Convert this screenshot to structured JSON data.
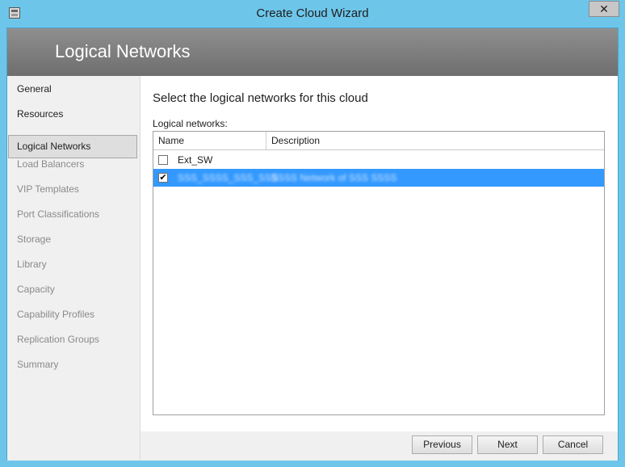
{
  "window": {
    "title": "Create Cloud Wizard",
    "close_label": "✕"
  },
  "header": {
    "title": "Logical Networks"
  },
  "nav": {
    "items": [
      {
        "label": "General",
        "state": "enabled"
      },
      {
        "label": "Resources",
        "state": "enabled"
      },
      {
        "label": "Logical Networks",
        "state": "selected"
      },
      {
        "label": "Load Balancers",
        "state": "disabled"
      },
      {
        "label": "VIP Templates",
        "state": "disabled"
      },
      {
        "label": "Port Classifications",
        "state": "disabled"
      },
      {
        "label": "Storage",
        "state": "disabled"
      },
      {
        "label": "Library",
        "state": "disabled"
      },
      {
        "label": "Capacity",
        "state": "disabled"
      },
      {
        "label": "Capability Profiles",
        "state": "disabled"
      },
      {
        "label": "Replication Groups",
        "state": "disabled"
      },
      {
        "label": "Summary",
        "state": "disabled"
      }
    ]
  },
  "main": {
    "heading": "Select the logical networks for this cloud",
    "list_label": "Logical networks:",
    "columns": {
      "name": "Name",
      "description": "Description"
    },
    "rows": [
      {
        "name": "Ext_SW",
        "description": "",
        "checked": false,
        "selected": false,
        "check_glyph": ""
      },
      {
        "name": "SSS_SSSS_SSS_SSS",
        "description": "SSSS Network of SSS SSSS",
        "checked": true,
        "selected": true,
        "check_glyph": "✔"
      }
    ]
  },
  "footer": {
    "previous_label": "Previous",
    "next_label": "Next",
    "cancel_label": "Cancel"
  },
  "colors": {
    "accent": "#6dc6ea",
    "header_bg": "#7f7f7f",
    "selection": "#3399ff"
  }
}
